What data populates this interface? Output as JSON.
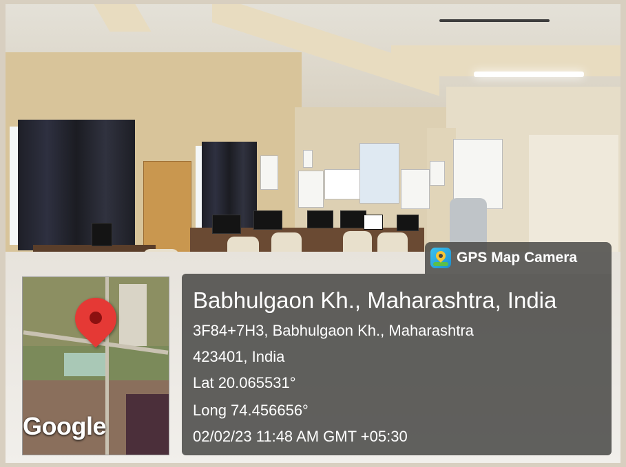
{
  "badge": {
    "icon": "map-pin-app-icon",
    "label": "GPS Map Camera"
  },
  "location": {
    "title": "Babhulgaon Kh., Maharashtra, India",
    "address_line1": "3F84+7H3, Babhulgaon Kh., Maharashtra",
    "address_line2": "423401, India",
    "lat": "Lat 20.065531°",
    "long": "Long 74.456656°",
    "timestamp": "02/02/23 11:48 AM GMT +05:30"
  },
  "map": {
    "watermark": "Google",
    "marker_color": "#e53935"
  }
}
